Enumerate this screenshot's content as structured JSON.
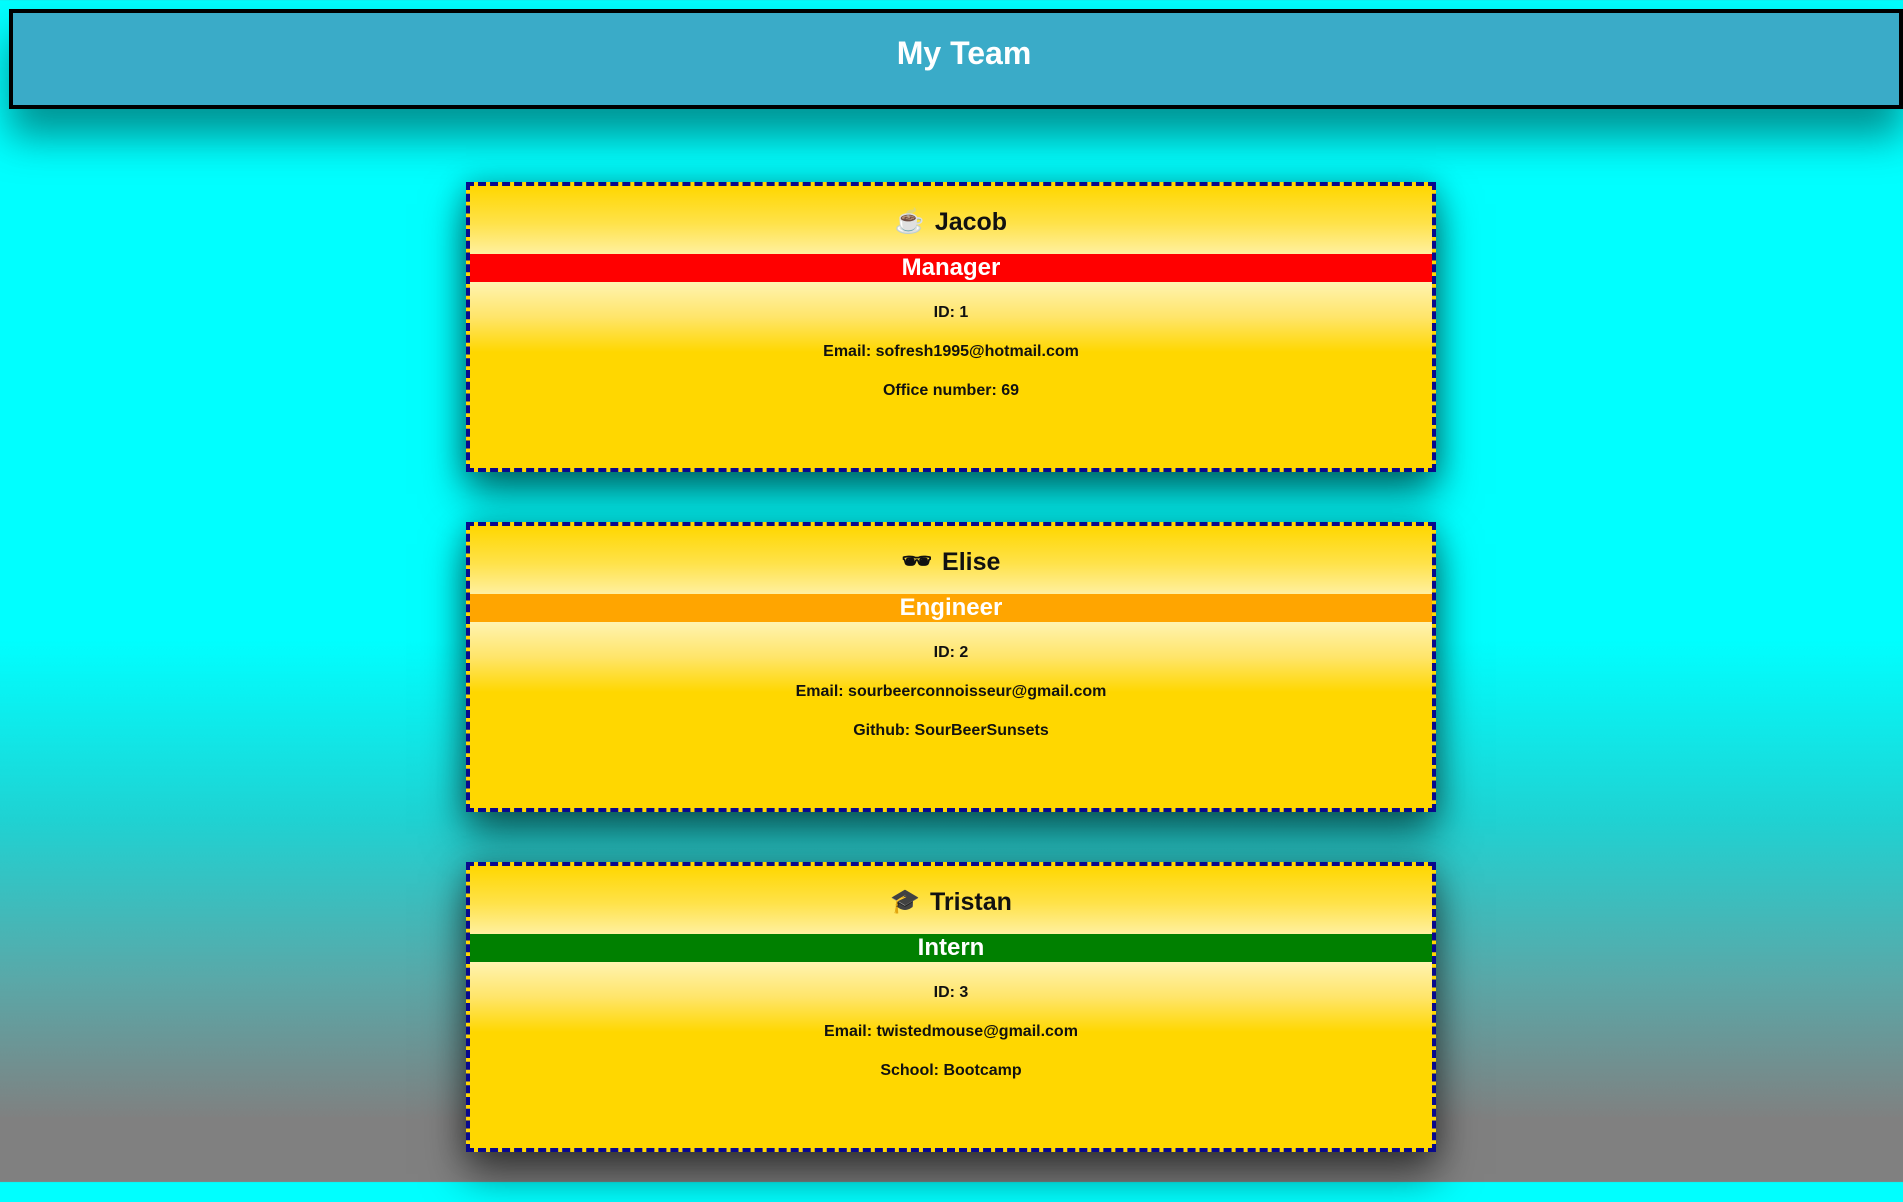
{
  "header": {
    "title": "My Team"
  },
  "colors": {
    "manager": "#ff0000",
    "engineer": "#ffa500",
    "intern": "#008000",
    "card_bg": "#ffd700",
    "header_bg": "#3aabc8"
  },
  "employees": [
    {
      "icon": "☕",
      "icon_name": "coffee-icon",
      "name": "Jacob",
      "role": "Manager",
      "id_line": "ID: 1",
      "email_line": "Email: sofresh1995@hotmail.com",
      "extra_line": "Office number: 69"
    },
    {
      "icon": "🕶",
      "icon_name": "sunglasses-icon",
      "name": "Elise",
      "role": "Engineer",
      "id_line": "ID: 2",
      "email_line": "Email: sourbeerconnoisseur@gmail.com",
      "extra_line": "Github: SourBeerSunsets"
    },
    {
      "icon": "🎓",
      "icon_name": "graduation-cap-icon",
      "name": "Tristan",
      "role": "Intern",
      "id_line": "ID: 3",
      "email_line": "Email: twistedmouse@gmail.com",
      "extra_line": "School: Bootcamp"
    }
  ]
}
